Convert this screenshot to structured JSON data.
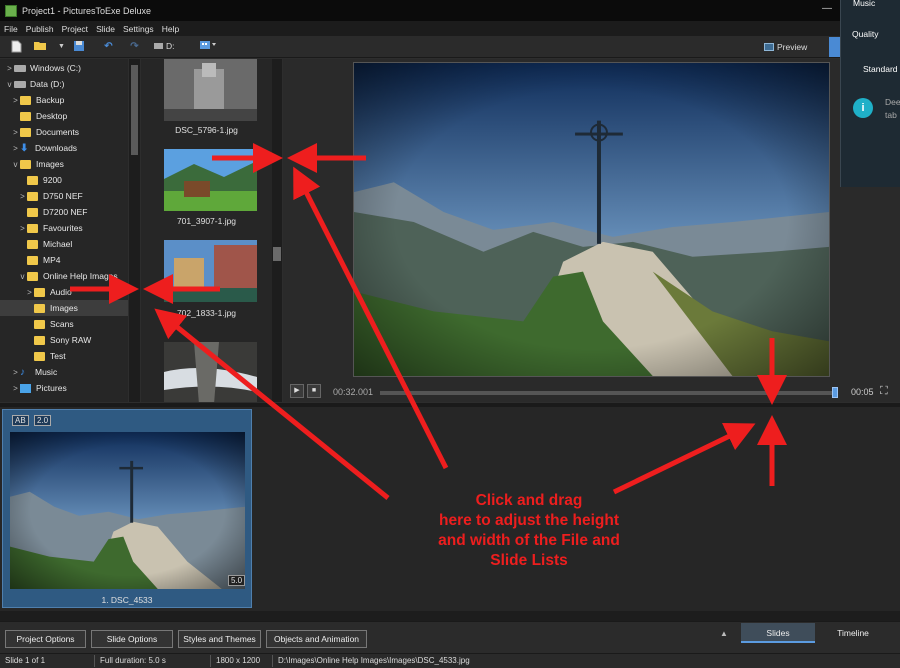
{
  "window": {
    "title": "Project1 - PicturesToExe Deluxe",
    "minimize": "—"
  },
  "menu": [
    "File",
    "Publish",
    "Project",
    "Slide",
    "Settings",
    "Help"
  ],
  "toolbar": {
    "drive_label": "D:",
    "preview_label": "Preview"
  },
  "overlay": {
    "music": "Music",
    "quality": "Quality",
    "standard": "Standard",
    "info_icon": "i",
    "info_text_1": "Dee",
    "info_text_2": "tab"
  },
  "tree": [
    {
      "label": "Windows (C:)",
      "icon": "drive-icon",
      "chev": ">"
    },
    {
      "label": "Data (D:)",
      "icon": "drive-icon",
      "chev": "v"
    },
    {
      "label": "Backup",
      "icon": "folder-icon",
      "chev": ">"
    },
    {
      "label": "Desktop",
      "icon": "folder-icon",
      "chev": ""
    },
    {
      "label": "Documents",
      "icon": "folder-icon",
      "chev": ">"
    },
    {
      "label": "Downloads",
      "icon": "download-icon",
      "chev": ">"
    },
    {
      "label": "Images",
      "icon": "folder-icon",
      "chev": "v"
    },
    {
      "label": "9200",
      "icon": "folder-icon",
      "chev": ""
    },
    {
      "label": "D750 NEF",
      "icon": "folder-icon",
      "chev": ">"
    },
    {
      "label": "D7200 NEF",
      "icon": "folder-icon",
      "chev": ""
    },
    {
      "label": "Favourites",
      "icon": "folder-icon",
      "chev": ">"
    },
    {
      "label": "Michael",
      "icon": "folder-icon",
      "chev": ""
    },
    {
      "label": "MP4",
      "icon": "folder-icon",
      "chev": ""
    },
    {
      "label": "Online Help Images",
      "icon": "folder-icon",
      "chev": "v"
    },
    {
      "label": "Audio",
      "icon": "folder-icon",
      "chev": ">"
    },
    {
      "label": "Images",
      "icon": "folder-icon",
      "chev": "",
      "selected": true
    },
    {
      "label": "Scans",
      "icon": "folder-icon",
      "chev": ""
    },
    {
      "label": "Sony RAW",
      "icon": "folder-icon",
      "chev": ""
    },
    {
      "label": "Test",
      "icon": "folder-icon",
      "chev": ""
    },
    {
      "label": "Music",
      "icon": "music-icon",
      "chev": ">"
    },
    {
      "label": "Pictures",
      "icon": "pictures-icon",
      "chev": ">"
    }
  ],
  "files": [
    "DSC_5796-1.jpg",
    "701_3907-1.jpg",
    "702_1833-1.jpg"
  ],
  "player": {
    "current_time": "00:32.001",
    "end_time": "00:05",
    "position": 0.998
  },
  "slide": {
    "badge_ab": "AB",
    "badge_version": "2.0",
    "duration": "5.0",
    "caption": "1. DSC_4533"
  },
  "bottom_buttons": [
    "Project Options",
    "Slide Options",
    "Styles and Themes",
    "Objects and Animation"
  ],
  "view_tabs": {
    "collapse_glyph": "▲",
    "slides": "Slides",
    "timeline": "Timeline"
  },
  "status": {
    "slide": "Slide 1 of 1",
    "duration": "Full duration: 5.0 s",
    "size": "1800 x 1200",
    "path": "D:\\Images\\Online Help Images\\Images\\DSC_4533.jpg"
  },
  "annotation": [
    "Click and drag",
    "here to adjust the height",
    "and width of the File and",
    "Slide Lists"
  ],
  "colors": {
    "annotation": "#ee1e1e",
    "accent": "#4a8ad4",
    "folder": "#f0c84a"
  }
}
